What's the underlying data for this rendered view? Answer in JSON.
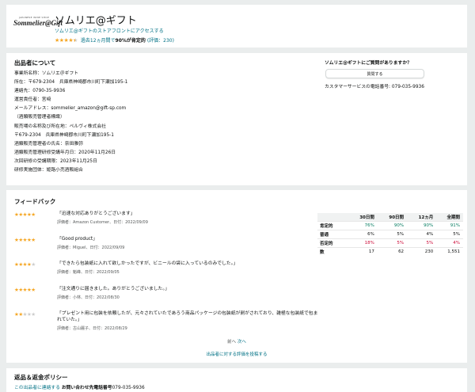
{
  "store": {
    "logo_tag": "JAPANESE WINE SHOP",
    "logo_name": "Sommelier@Gift",
    "title": "ソムリエ@ギフト",
    "storefront_link": "ソムリエ@ギフトのストアフロントにアクセスする",
    "rating_stars": 4.5,
    "rating_prefix": "過去12ヵ月間で",
    "rating_bold": "90%が肯定的",
    "rating_count": "(評価：230)"
  },
  "seller": {
    "title": "出品者について",
    "lines": [
      "事業所名称：ソムリエ＠ギフト",
      "所在：〒679-2304　兵庫県神崎郡市川町下瀬加195-1",
      "連絡先：0790-35-9936",
      "運営責任者：宮﨑",
      "メールアドレス：sommelier_amazon@gift-sp.com",
      "（酒類販売管理者標識）",
      "販売場の名称及び所在地：ペルヴィ株式会社",
      "〒679-2304　兵庫県神崎郡市川町下瀬加195-1",
      "酒類販売管理者の氏名：奈田雅弥",
      "酒類販売管理研修受講年月日：2020年11月26日",
      "次回研修の受講期限：2023年11月25日",
      "研修実施団体：姫路小売酒販組合"
    ],
    "contact": {
      "question": "ソムリエ@ギフトにご質問がありますか？",
      "button": "質問する",
      "phone": "カスタマーサービスの電話番号: 079-035-9936"
    }
  },
  "feedback": {
    "title": "フィードバック",
    "items": [
      {
        "stars": 5,
        "comment": "「迅速な対応ありがとうございます」",
        "meta": "評価者：Amazon Customer、日付：2022/09/09"
      },
      {
        "stars": 5,
        "comment": "「Good product」",
        "meta": "評価者：Miguel、日付：2022/09/09"
      },
      {
        "stars": 4,
        "comment": "「できたら包装紙に入れて欲しかったですが、ビニールの袋に入っているのみでした。」",
        "meta": "評価者：魁峰、日付：2022/09/05"
      },
      {
        "stars": 5,
        "comment": "「注文通りに届きました。ありがとうございました。」",
        "meta": "評価者：小林、日付：2022/08/30"
      },
      {
        "stars": 2,
        "comment": "「プレゼント用に包装を依頼したが、元々されていたであろう商品パッケージの包装紙が剥がされており、雑極な包装紙で包まれていた。」",
        "meta": "評価者：古山麗子、日付：2022/08/29"
      }
    ],
    "stats": {
      "headers": [
        "",
        "30日間",
        "90日間",
        "12ヵ月",
        "全期間"
      ],
      "rows": [
        {
          "label": "肯定的",
          "values": [
            "76%",
            "90%",
            "90%",
            "91%"
          ],
          "kind": "pos"
        },
        {
          "label": "普通",
          "values": [
            "6%",
            "5%",
            "4%",
            "5%"
          ],
          "kind": "neutral"
        },
        {
          "label": "否定的",
          "values": [
            "18%",
            "5%",
            "5%",
            "4%"
          ],
          "kind": "neg"
        },
        {
          "label": "数",
          "values": [
            "17",
            "62",
            "230",
            "1,551"
          ],
          "kind": "count"
        }
      ]
    },
    "pager_prev": "前へ",
    "pager_next": "次へ",
    "review_link": "出品者に対する評価を投稿する"
  },
  "returns": {
    "title": "返品＆返金ポリシー",
    "contact_link": "この出品者に連絡する",
    "phone_bold": "お問い合わせ先電話番号",
    "phone": "079-035-9936"
  },
  "colors": {
    "accent_link": "#007185",
    "star": "#f5a623",
    "positive": "#067d62",
    "negative": "#cc0c39"
  }
}
